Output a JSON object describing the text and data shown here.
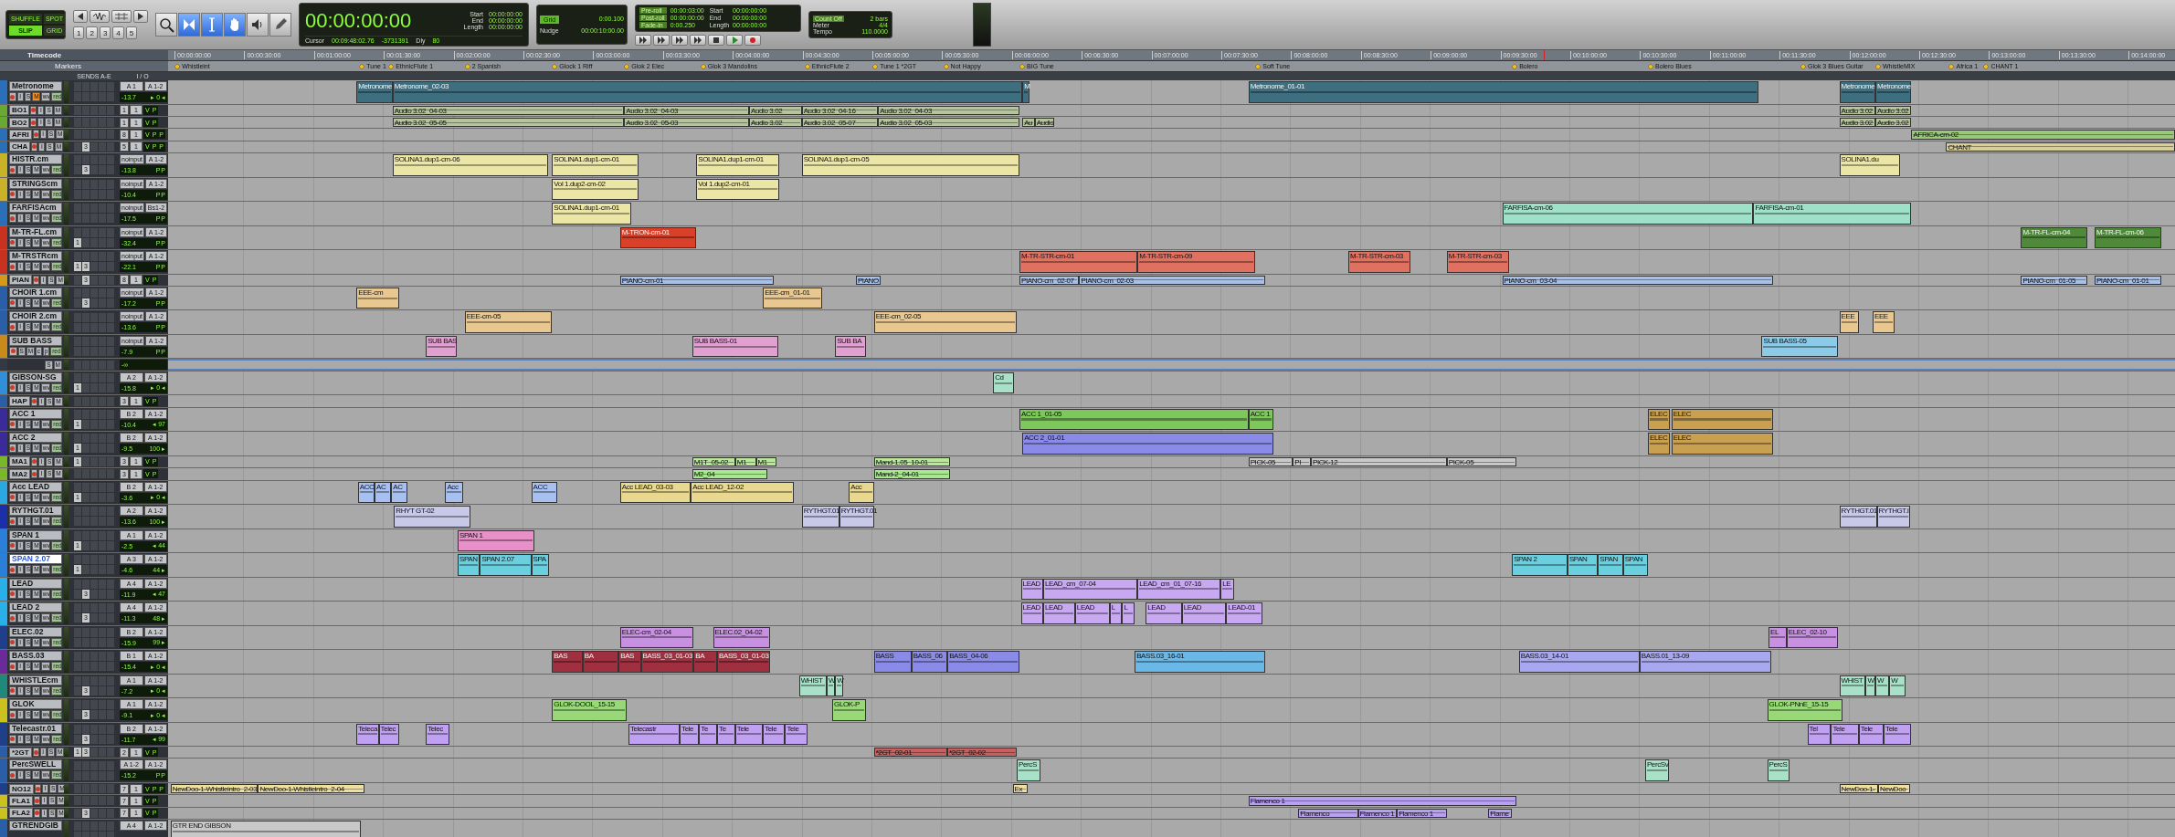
{
  "toolbar": {
    "edit_modes": [
      {
        "label": "SHUFFLE",
        "selected": false
      },
      {
        "label": "SPOT",
        "selected": false
      },
      {
        "label": "SLIP",
        "selected": true
      },
      {
        "label": "GRID",
        "selected": false
      }
    ],
    "zoom_presets": [
      "1",
      "2",
      "3",
      "4",
      "5"
    ],
    "tools": [
      {
        "kind": "zoomer",
        "selected": false
      },
      {
        "kind": "trimmer",
        "selected": true
      },
      {
        "kind": "selector",
        "selected": true
      },
      {
        "kind": "grabber",
        "selected": true
      },
      {
        "kind": "scrubber",
        "selected": false
      },
      {
        "kind": "pencil",
        "selected": false
      }
    ],
    "counter": {
      "main": "00:00:00:00",
      "selection": [
        {
          "label": "Start",
          "value": "00:00:00:00"
        },
        {
          "label": "End",
          "value": "00:00:00:00"
        },
        {
          "label": "Length",
          "value": "00:00:00:00"
        }
      ],
      "cursor_label": "Cursor",
      "cursor": "00:09:48:02.76",
      "sample": "-3731391",
      "delay_label": "Dly",
      "value": "80"
    },
    "grid": {
      "label": "Grid",
      "value": "0:00.100",
      "nudge_label": "Nudge",
      "nudge": "00:00:10:00.00"
    },
    "transport": {
      "rolls": [
        {
          "label": "Pre-roll",
          "value": "00:00:03:00"
        },
        {
          "label": "Post-roll",
          "value": "00:00:00:00"
        },
        {
          "label": "Fade-in",
          "value": "0:00.250"
        }
      ],
      "selection": [
        {
          "label": "Start",
          "value": "00:00:00:00"
        },
        {
          "label": "End",
          "value": "00:00:00:00"
        },
        {
          "label": "Length",
          "value": "00:00:00:00"
        }
      ]
    },
    "tempo": {
      "count_off": "Count Off",
      "bars": "2 bars",
      "meter_label": "Meter",
      "meter": "4/4",
      "tempo_label": "Tempo",
      "tempo": "110.0000"
    }
  },
  "ruler": {
    "label": "Timecode",
    "ticks": [
      "00:00:00:00",
      "00:00:30:00",
      "00:01:00:00",
      "00:01:30:00",
      "00:02:00:00",
      "00:02:30:00",
      "00:03:00:00",
      "00:03:30:00",
      "00:04:00:00",
      "00:04:30:00",
      "00:05:00:00",
      "00:05:30:00",
      "00:06:00:00",
      "00:06:30:00",
      "00:07:00:00",
      "00:07:30:00",
      "00:08:00:00",
      "00:08:30:00",
      "00:09:00:00",
      "00:09:30:00",
      "00:10:00:00",
      "00:10:30:00",
      "00:11:00:00",
      "00:11:30:00",
      "00:12:00:00",
      "00:12:30:00",
      "00:13:00:00",
      "00:13:30:00",
      "00:14:00:00"
    ]
  },
  "markers": {
    "label": "Markers",
    "items": [
      "Whistleint",
      "Tune 1",
      "EthnicFlute 1",
      "2 Spanish",
      "Glock 1 Riff",
      "Glok 2 Elec",
      "Glok 3 Mandolins",
      "EthnicFlute 2",
      "Tune 1 *2GT",
      "Not Happy",
      "BIG Tune",
      "Soft Tune",
      "Bolero",
      "Bolero Blues",
      "Glok 3 Blues Guitar",
      "WhistleMIX",
      "Africa 1",
      "CHANT 1"
    ]
  },
  "track_columns": {
    "sends": "SENDS A-E",
    "io": "I / O"
  },
  "tracks": [
    {
      "name": "Metronome",
      "kind": "double",
      "color": "#2a6fb8",
      "selected": false,
      "muted": true,
      "input_monitor": "I",
      "solo": "S",
      "mute": "M",
      "view": "wv",
      "automation": "red",
      "input": "A 1",
      "output": "A 1-2",
      "volume": "-13.7",
      "pan": "▸ 0 ◂",
      "clips": [
        {
          "name": "Metronome",
          "color": "#3d6f80"
        },
        {
          "name": "Metronome_02-03",
          "color": "#3d6f80"
        },
        {
          "name": "M",
          "color": "#3d6f80"
        },
        {
          "name": "Metronome_01-01",
          "color": "#3d6f80"
        },
        {
          "name": "Metronome",
          "color": "#3d6f80"
        },
        {
          "name": "Metronome",
          "color": "#3d6f80"
        }
      ]
    },
    {
      "name": "BO1",
      "kind": "single",
      "color": "#6aa834",
      "selected": false,
      "muted": false,
      "input_monitor": "I",
      "solo": "S",
      "mute": "M",
      "input": "1",
      "output": "1",
      "tags": [
        "V",
        "P"
      ],
      "clips": [
        {
          "name": "Audio 3.02_04-03",
          "color": "#b5c49a"
        },
        {
          "name": "Audio 3.02_04-03",
          "color": "#b5c49a"
        },
        {
          "name": "Audio 3.02",
          "color": "#b5c49a"
        },
        {
          "name": "Audio 3.02_04-16",
          "color": "#b5c49a"
        },
        {
          "name": "Audio 3.02_04-03",
          "color": "#b5c49a"
        },
        {
          "name": "Audio 3.02",
          "color": "#b5c49a"
        },
        {
          "name": "Audio 3.02",
          "color": "#b5c49a"
        }
      ]
    },
    {
      "name": "BO2",
      "kind": "single",
      "color": "#6aa834",
      "selected": false,
      "muted": false,
      "input_monitor": "I",
      "solo": "S",
      "mute": "M",
      "input": "1",
      "output": "1",
      "tags": [
        "V",
        "P"
      ],
      "clips": [
        {
          "name": "Audio 3.02_05-05",
          "color": "#b5c49a"
        },
        {
          "name": "Audio 3.02_05-03",
          "color": "#b5c49a"
        },
        {
          "name": "Audio 3.02",
          "color": "#b5c49a"
        },
        {
          "name": "Audio 3.02_05-07",
          "color": "#b5c49a"
        },
        {
          "name": "Audio 3.02_05-03",
          "color": "#b5c49a"
        },
        {
          "name": "Au",
          "color": "#b5c49a"
        },
        {
          "name": "Audio",
          "color": "#b5c49a"
        },
        {
          "name": "Audio 3.02",
          "color": "#b5c49a"
        },
        {
          "name": "Audio 3.02",
          "color": "#b5c49a"
        }
      ]
    },
    {
      "name": "AFRI",
      "kind": "single",
      "color": "#2a6fb8",
      "selected": false,
      "muted": false,
      "input_monitor": "I",
      "solo": "S",
      "mute": "M",
      "input": "8",
      "output": "1",
      "tags": [
        "V",
        "P",
        "P"
      ],
      "clips": [
        {
          "name": "AFRICA-cm-02",
          "color": "#9ac87a"
        }
      ]
    },
    {
      "name": "CHA",
      "kind": "single",
      "color": "#2a6fb8",
      "selected": false,
      "muted": false,
      "input_monitor": "I",
      "solo": "S",
      "mute": "M",
      "sends": {
        "B": "3"
      },
      "input": "5",
      "output": "1",
      "tags": [
        "V",
        "P",
        "P"
      ],
      "clips": [
        {
          "name": "CHANT",
          "color": "#d8cf98"
        }
      ]
    },
    {
      "name": "HISTR.cm",
      "kind": "double",
      "color": "#c9b227",
      "selected": false,
      "muted": false,
      "input_monitor": "I",
      "solo": "S",
      "mute": "M",
      "view": "wv",
      "automation": "red",
      "sends": {
        "B": "3"
      },
      "input": "noinput",
      "output": "A 1-2",
      "volume": "-13.8",
      "tags": [
        "P",
        "P"
      ],
      "clips": [
        {
          "name": "SOLINA1.dup1-cm-06",
          "color": "#ece6a6"
        },
        {
          "name": "SOLINA1.dup1-cm-01",
          "color": "#ece6a6"
        },
        {
          "name": "SOLINA1.dup1-cm-01",
          "color": "#ece6a6"
        },
        {
          "name": "SOLINA1.dup1-cm-05",
          "color": "#ece6a6"
        },
        {
          "name": "SOLINA1.du",
          "color": "#ece6a6"
        }
      ]
    },
    {
      "name": "STRINGScm",
      "kind": "double",
      "color": "#c9b227",
      "selected": false,
      "muted": false,
      "input_monitor": "I",
      "solo": "S",
      "mute": "M",
      "view": "wv",
      "automation": "red",
      "input": "noinput",
      "output": "A 1-2",
      "volume": "-10.4",
      "tags": [
        "P",
        "P"
      ],
      "clips": [
        {
          "name": "Vol 1.dup2-cm-02",
          "color": "#ece6a6"
        },
        {
          "name": "Vol 1.dup2-cm-01",
          "color": "#ece6a6"
        }
      ]
    },
    {
      "name": "FARFISAcm",
      "kind": "double",
      "color": "#2a6fb8",
      "selected": false,
      "muted": false,
      "input_monitor": "I",
      "solo": "S",
      "mute": "M",
      "view": "wv",
      "automation": "red",
      "input": "noinput",
      "output": "Bs1-2",
      "volume": "-17.5",
      "tags": [
        "P",
        "P"
      ],
      "clips": [
        {
          "name": "SOLINA1.dup1-cm-01",
          "color": "#ece6a6"
        },
        {
          "name": "FARFISA-cm-06",
          "color": "#9fe0c8"
        },
        {
          "name": "FARFISA-cm-01",
          "color": "#9fe0c8"
        }
      ]
    },
    {
      "name": "M-TR-FL.cm",
      "kind": "double",
      "color": "#c8321e",
      "selected": false,
      "muted": false,
      "input_monitor": "I",
      "solo": "S",
      "mute": "M",
      "view": "wv",
      "automation": "red",
      "sends": {
        "A": "1"
      },
      "input": "noinput",
      "output": "A 1-2",
      "volume": "-32.4",
      "tags": [
        "P",
        "P"
      ],
      "clips": [
        {
          "name": "M-TRON-cm-01",
          "color": "#d8402a"
        },
        {
          "name": "M-TR-FL-cm-04",
          "color": "#4f8a3a"
        },
        {
          "name": "M-TR-FL-cm-06",
          "color": "#4f8a3a"
        }
      ]
    },
    {
      "name": "M-TRSTRcm",
      "kind": "double",
      "color": "#c8321e",
      "selected": false,
      "muted": false,
      "input_monitor": "I",
      "solo": "S",
      "mute": "M",
      "view": "wv",
      "automation": "red",
      "sends": {
        "A": "1",
        "B": "3"
      },
      "input": "noinput",
      "output": "A 1-2",
      "volume": "-22.1",
      "tags": [
        "P",
        "P"
      ],
      "clips": [
        {
          "name": "M-TR-STR-cm-01",
          "color": "#e07060"
        },
        {
          "name": "M-TR-STR-cm-09",
          "color": "#e07060"
        },
        {
          "name": "M-TR-STR-cm-03",
          "color": "#e07060"
        },
        {
          "name": "M-TR-STR-cm-03",
          "color": "#e07060"
        }
      ]
    },
    {
      "name": "PIAN",
      "kind": "single",
      "color": "#d69a1a",
      "selected": false,
      "muted": false,
      "input_monitor": "I",
      "solo": "S",
      "mute": "M",
      "sends": {
        "B": "3"
      },
      "input": "8",
      "output": "1",
      "tags": [
        "V",
        "P"
      ],
      "clips": [
        {
          "name": "PIANO-cm-01",
          "color": "#a8c0e8"
        },
        {
          "name": "PIANO",
          "color": "#a8c0e8"
        },
        {
          "name": "PIANO-cm_02-07",
          "color": "#a8c0e8"
        },
        {
          "name": "PIANO-cm_02-03",
          "color": "#a8c0e8"
        },
        {
          "name": "PIANO-cm_03-04",
          "color": "#a8c0e8"
        },
        {
          "name": "PIANO-cm_01-05",
          "color": "#a8c0e8"
        },
        {
          "name": "PIANO-cm_01-01",
          "color": "#a8c0e8"
        }
      ]
    },
    {
      "name": "CHOIR 1.cm",
      "kind": "double",
      "color": "#2a5fa8",
      "selected": false,
      "muted": false,
      "input_monitor": "I",
      "solo": "S",
      "mute": "M",
      "view": "wv",
      "automation": "red",
      "sends": {
        "B": "3"
      },
      "input": "noinput",
      "output": "A 1-2",
      "volume": "-17.2",
      "tags": [
        "P",
        "P"
      ],
      "clips": [
        {
          "name": "EEE-cm",
          "color": "#e8c890"
        },
        {
          "name": "EEE-cm_01-01",
          "color": "#e8c890"
        }
      ]
    },
    {
      "name": "CHOIR 2.cm",
      "kind": "double",
      "color": "#2a5fa8",
      "selected": false,
      "muted": false,
      "input_monitor": "I",
      "solo": "S",
      "mute": "M",
      "view": "wv",
      "automation": "red",
      "input": "noinput",
      "output": "A 1-2",
      "volume": "-13.6",
      "tags": [
        "P",
        "P"
      ],
      "clips": [
        {
          "name": "EEE-cm-05",
          "color": "#e8c890"
        },
        {
          "name": "EEE-cm_02-05",
          "color": "#e8c890"
        },
        {
          "name": "EEE",
          "color": "#e8c890"
        },
        {
          "name": "EEE",
          "color": "#e8c890"
        }
      ]
    },
    {
      "name": "SUB BASS",
      "kind": "double",
      "color": "#c88a1a",
      "selected": false,
      "muted": false,
      "solo": "S",
      "mute": "M",
      "extras": [
        "c",
        "p"
      ],
      "automation": "red",
      "input": "noinput",
      "output": "A 1-2",
      "volume": "-7.9",
      "tags": [
        "P",
        "P"
      ],
      "clips": [
        {
          "name": "SUB BAS",
          "color": "#e0a0d0"
        },
        {
          "name": "SUB BASS-01",
          "color": "#e0a0d0"
        },
        {
          "name": "SUB BA",
          "color": "#e0a0d0"
        },
        {
          "name": "SUB BASS-05",
          "color": "#8ccbe8"
        }
      ]
    },
    {
      "kind": "blank",
      "color": "#333a44",
      "selected": false,
      "muted": false,
      "solo": "S",
      "mute": "M",
      "volume": "-∞"
    },
    {
      "name": "GIBSON-SG",
      "kind": "double",
      "color": "#2f8fd8",
      "selected": false,
      "muted": false,
      "input_monitor": "I",
      "solo": "S",
      "mute": "M",
      "view": "wv",
      "automation": "red",
      "sends": {
        "A": "1"
      },
      "input": "A 2",
      "output": "A 1-2",
      "volume": "-15.8",
      "pan": "▸ 0 ◂",
      "clips": [
        {
          "name": "Cd",
          "color": "#a8e0c8"
        }
      ]
    },
    {
      "name": "HAP",
      "kind": "single",
      "color": "#2a5fa8",
      "selected": false,
      "muted": false,
      "input_monitor": "I",
      "solo": "S",
      "mute": "M",
      "input": "3",
      "output": "1",
      "tags": [
        "V",
        "P"
      ]
    },
    {
      "name": "ACC 1",
      "kind": "double",
      "color": "#3b2a9a",
      "selected": false,
      "muted": false,
      "input_monitor": "I",
      "solo": "S",
      "mute": "M",
      "view": "wv",
      "automation": "red",
      "sends": {
        "A": "1"
      },
      "input": "B 2",
      "output": "A 1-2",
      "volume": "-10.4",
      "pan": "◂ 97",
      "clips": [
        {
          "name": "ACC 1_01-05",
          "color": "#7cc85a"
        },
        {
          "name": "ACC 1",
          "color": "#7cc85a"
        },
        {
          "name": "ELEC",
          "color": "#c8a050"
        },
        {
          "name": "ELEC",
          "color": "#c8a050"
        }
      ]
    },
    {
      "name": "ACC 2",
      "kind": "double",
      "color": "#3b2a9a",
      "selected": false,
      "muted": false,
      "input_monitor": "I",
      "solo": "S",
      "mute": "M",
      "view": "wv",
      "automation": "red",
      "sends": {
        "A": "1"
      },
      "input": "B 2",
      "output": "A 1-2",
      "volume": "-9.5",
      "pan": "100 ▸",
      "clips": [
        {
          "name": "ACC 2_01-01",
          "color": "#8a8ae8"
        },
        {
          "name": "ELEC",
          "color": "#c8a050"
        },
        {
          "name": "ELEC",
          "color": "#c8a050"
        }
      ]
    },
    {
      "name": "MA1",
      "kind": "single",
      "color": "#7ab82a",
      "selected": false,
      "muted": false,
      "input_monitor": "I",
      "solo": "S",
      "mute": "M",
      "sends": {
        "A": "1"
      },
      "input": "3",
      "output": "1",
      "tags": [
        "V",
        "P"
      ],
      "clips": [
        {
          "name": "M1T_05-02",
          "color": "#b8e898"
        },
        {
          "name": "M1",
          "color": "#b8e898"
        },
        {
          "name": "M1",
          "color": "#b8e898"
        },
        {
          "name": "Mand-1.05_10-01",
          "color": "#b8e898"
        },
        {
          "name": "PICK-05",
          "color": "#c8c8c8"
        },
        {
          "name": "PI",
          "color": "#c8c8c8"
        },
        {
          "name": "PICK-12",
          "color": "#c8c8c8"
        },
        {
          "name": "PICK-05",
          "color": "#c8c8c8"
        }
      ]
    },
    {
      "name": "MA2",
      "kind": "single",
      "color": "#7ab82a",
      "selected": false,
      "muted": false,
      "input_monitor": "I",
      "solo": "S",
      "mute": "M",
      "input": "3",
      "output": "1",
      "tags": [
        "V",
        "P"
      ],
      "clips": [
        {
          "name": "M2_04",
          "color": "#a8e890"
        },
        {
          "name": "Mand-2_04-01",
          "color": "#a8e890"
        }
      ]
    },
    {
      "name": "Acc LEAD",
      "kind": "double",
      "color": "#2aa8e0",
      "selected": false,
      "muted": false,
      "input_monitor": "I",
      "solo": "S",
      "mute": "M",
      "view": "wv",
      "automation": "red",
      "sends": {
        "A": "1"
      },
      "input": "B 2",
      "output": "A 1-2",
      "volume": "-3.6",
      "pan": "▸ 0 ◂",
      "clips": [
        {
          "name": "ACC",
          "color": "#a8c0f0"
        },
        {
          "name": "AC",
          "color": "#a8c0f0"
        },
        {
          "name": "AC",
          "color": "#a8c0f0"
        },
        {
          "name": "Acc",
          "color": "#a8c0f0"
        },
        {
          "name": "ACC",
          "color": "#a8c0f0"
        },
        {
          "name": "Acc LEAD_03-03",
          "color": "#e8d890"
        },
        {
          "name": "Acc LEAD_12-02",
          "color": "#e8d890"
        },
        {
          "name": "Acc",
          "color": "#e8d890"
        }
      ]
    },
    {
      "name": "RYTHGT.01",
      "kind": "double",
      "color": "#1a2fa8",
      "selected": false,
      "muted": false,
      "input_monitor": "I",
      "solo": "S",
      "mute": "M",
      "view": "wv",
      "automation": "red",
      "input": "A 2",
      "output": "A 1-2",
      "volume": "-13.6",
      "pan": "100 ▸",
      "clips": [
        {
          "name": "RHYT GT-02",
          "color": "#c8c8e8"
        },
        {
          "name": "RYTHGT.01",
          "color": "#c8c8e8"
        },
        {
          "name": "RYTHGT.01",
          "color": "#c8c8e8"
        },
        {
          "name": "RYTHGT.01",
          "color": "#c8c8e8"
        },
        {
          "name": "RYTHGT.I",
          "color": "#c8c8e8"
        }
      ]
    },
    {
      "name": "SPAN 1",
      "kind": "double",
      "color": "#2a7fd8",
      "selected": false,
      "muted": false,
      "input_monitor": "I",
      "solo": "S",
      "mute": "M",
      "view": "wv",
      "automation": "red",
      "sends": {
        "A": "1"
      },
      "input": "A 1",
      "output": "A 1-2",
      "volume": "-2.5",
      "pan": "◂ 44",
      "clips": [
        {
          "name": "SPAN 1",
          "color": "#e890c8"
        }
      ]
    },
    {
      "name": "SPAN 2.07",
      "kind": "double",
      "color": "#2a7fd8",
      "selected": true,
      "muted": false,
      "input_monitor": "I",
      "solo": "S",
      "mute": "M",
      "view": "wv",
      "automation": "red",
      "sends": {
        "A": "1"
      },
      "input": "A 3",
      "output": "A 1-2",
      "volume": "-4.6",
      "pan": "44 ▸",
      "clips": [
        {
          "name": "SPAN",
          "color": "#6ad0e0"
        },
        {
          "name": "SPAN 2.07",
          "color": "#6ad0e0"
        },
        {
          "name": "SPA",
          "color": "#6ad0e0"
        },
        {
          "name": "SPAN 2",
          "color": "#6ad0e0"
        },
        {
          "name": "SPAN",
          "color": "#6ad0e0"
        },
        {
          "name": "SPAN",
          "color": "#6ad0e0"
        },
        {
          "name": "SPAN",
          "color": "#6ad0e0"
        }
      ]
    },
    {
      "name": "LEAD",
      "kind": "double",
      "color": "#2ab0e8",
      "selected": false,
      "muted": false,
      "input_monitor": "I",
      "solo": "S",
      "mute": "M",
      "view": "wv",
      "automation": "red",
      "sends": {
        "B": "3"
      },
      "input": "A 4",
      "output": "A 1-2",
      "volume": "-11.9",
      "pan": "◂ 47",
      "clips": [
        {
          "name": "LEAD",
          "color": "#c8a8f0"
        },
        {
          "name": "LEAD_cm_07-04",
          "color": "#c8a8f0"
        },
        {
          "name": "LEAD_cm_01_07-16",
          "color": "#c8a8f0"
        },
        {
          "name": "LE",
          "color": "#c8a8f0"
        }
      ]
    },
    {
      "name": "LEAD 2",
      "kind": "double",
      "color": "#2ab0e8",
      "selected": false,
      "muted": false,
      "input_monitor": "I",
      "solo": "S",
      "mute": "M",
      "view": "wv",
      "automation": "red",
      "sends": {
        "B": "3"
      },
      "input": "A 4",
      "output": "A 1-2",
      "volume": "-11.3",
      "pan": "48 ▸",
      "clips": [
        {
          "name": "LEAD",
          "color": "#c8a8f0"
        },
        {
          "name": "LEAD",
          "color": "#c8a8f0"
        },
        {
          "name": "LEAD",
          "color": "#c8a8f0"
        },
        {
          "name": "L",
          "color": "#c8a8f0"
        },
        {
          "name": "L",
          "color": "#c8a8f0"
        },
        {
          "name": "LEAD",
          "color": "#c8a8f0"
        },
        {
          "name": "LEAD",
          "color": "#c8a8f0"
        },
        {
          "name": "LEAD-01",
          "color": "#c8a8f0"
        }
      ]
    },
    {
      "name": "ELEC.02",
      "kind": "double",
      "color": "#1f3f8a",
      "selected": false,
      "muted": false,
      "input_monitor": "I",
      "solo": "S",
      "mute": "M",
      "view": "wv",
      "automation": "red",
      "input": "B 2",
      "output": "A 1-2",
      "volume": "-15.9",
      "pan": "99 ▸",
      "clips": [
        {
          "name": "ELEC-cm_02-04",
          "color": "#c890e0"
        },
        {
          "name": "ELEC.02_04-02",
          "color": "#c890e0"
        },
        {
          "name": "EL",
          "color": "#c890e0"
        },
        {
          "name": "ELEC_02-10",
          "color": "#c890e0"
        }
      ]
    },
    {
      "name": "BASS.03",
      "kind": "double",
      "color": "#6a2a9a",
      "selected": false,
      "muted": false,
      "input_monitor": "I",
      "solo": "S",
      "mute": "M",
      "view": "wv",
      "automation": "red",
      "input": "B 1",
      "output": "A 1-2",
      "volume": "-15.4",
      "pan": "▸ 0 ◂",
      "clips": [
        {
          "name": "BAS",
          "color": "#a03040"
        },
        {
          "name": "BA",
          "color": "#a03040"
        },
        {
          "name": "BAS",
          "color": "#a03040"
        },
        {
          "name": "BASS_03_01-03",
          "color": "#a03040"
        },
        {
          "name": "BA",
          "color": "#a03040"
        },
        {
          "name": "BASS_03_01-03",
          "color": "#a03040"
        },
        {
          "name": "BASS",
          "color": "#8a8ae8"
        },
        {
          "name": "BASS_06",
          "color": "#8a8ae8"
        },
        {
          "name": "BASS_04-06",
          "color": "#8a8ae8"
        },
        {
          "name": "BASS.03_16-01",
          "color": "#6ab8e8"
        },
        {
          "name": "BASS.03_14-01",
          "color": "#a8a8f0"
        },
        {
          "name": "BASS.01_13-09",
          "color": "#a8a8f0"
        }
      ]
    },
    {
      "name": "WHISTLEcm",
      "kind": "double",
      "color": "#1f8a7a",
      "selected": false,
      "muted": false,
      "input_monitor": "I",
      "solo": "S",
      "mute": "M",
      "view": "wv",
      "automation": "red",
      "sends": {
        "B": "3"
      },
      "input": "A 1",
      "output": "A 1-2",
      "volume": "-7.2",
      "pan": "▸ 0 ◂",
      "clips": [
        {
          "name": "WHIST",
          "color": "#a8e0c8"
        },
        {
          "name": "W",
          "color": "#a8e0c8"
        },
        {
          "name": "W",
          "color": "#a8e0c8"
        },
        {
          "name": "WHIST",
          "color": "#a8e0c8"
        },
        {
          "name": "W",
          "color": "#a8e0c8"
        },
        {
          "name": "W",
          "color": "#a8e0c8"
        },
        {
          "name": "W",
          "color": "#a8e0c8"
        }
      ]
    },
    {
      "name": "GLOK",
      "kind": "double",
      "color": "#c9c21f",
      "selected": false,
      "muted": false,
      "input_monitor": "I",
      "solo": "S",
      "mute": "M",
      "view": "wv",
      "automation": "red",
      "sends": {
        "B": "3"
      },
      "input": "A 1",
      "output": "A 1-2",
      "volume": "-9.1",
      "pan": "▸ 0 ◂",
      "clips": [
        {
          "name": "GLOK-DOOL_15-15",
          "color": "#98d878"
        },
        {
          "name": "GLOK-P",
          "color": "#98d878"
        },
        {
          "name": "GLOK-PNnE_15-15",
          "color": "#98d878"
        }
      ]
    },
    {
      "name": "Telecastr.01",
      "kind": "double",
      "color": "#1f3f8a",
      "selected": false,
      "muted": false,
      "input_monitor": "I",
      "solo": "S",
      "mute": "M",
      "view": "wv",
      "automation": "red",
      "sends": {
        "B": "3"
      },
      "input": "B 2",
      "output": "A 1-2",
      "volume": "-11.7",
      "pan": "◂ 99",
      "clips": [
        {
          "name": "Teleca",
          "color": "#c0a0f0"
        },
        {
          "name": "Telec",
          "color": "#c0a0f0"
        },
        {
          "name": "Telec",
          "color": "#c0a0f0"
        },
        {
          "name": "Telecastr",
          "color": "#c0a0f0"
        },
        {
          "name": "Tele",
          "color": "#c0a0f0"
        },
        {
          "name": "Te",
          "color": "#c0a0f0"
        },
        {
          "name": "Te",
          "color": "#c0a0f0"
        },
        {
          "name": "Tele",
          "color": "#c0a0f0"
        },
        {
          "name": "Tele",
          "color": "#c0a0f0"
        },
        {
          "name": "Tele",
          "color": "#c0a0f0"
        },
        {
          "name": "Tel",
          "color": "#c0a0f0"
        },
        {
          "name": "Tele",
          "color": "#c0a0f0"
        },
        {
          "name": "Tele",
          "color": "#c0a0f0"
        },
        {
          "name": "Tele",
          "color": "#c0a0f0"
        }
      ]
    },
    {
      "name": "*2GT",
      "kind": "single",
      "color": "#2a5fa8",
      "selected": false,
      "muted": false,
      "input_monitor": "I",
      "solo": "S",
      "mute": "M",
      "sends": {
        "A": "1",
        "B": "3"
      },
      "input": "2",
      "output": "1",
      "tags": [
        "V",
        "P"
      ],
      "clips": [
        {
          "name": "*2GT_02-01",
          "color": "#c86060"
        },
        {
          "name": "*2GT_02-02",
          "color": "#c86060"
        }
      ]
    },
    {
      "name": "PercSWELL",
      "kind": "double",
      "color": "#2a5fa8",
      "selected": false,
      "muted": false,
      "input_monitor": "I",
      "solo": "S",
      "mute": "M",
      "view": "wv",
      "automation": "red",
      "input": "A 1-2",
      "output": "A 1-2",
      "volume": "-15.2",
      "tags": [
        "P",
        "P"
      ],
      "clips": [
        {
          "name": "PercS",
          "color": "#a8e0c8"
        },
        {
          "name": "PercSv",
          "color": "#a8e0c8"
        },
        {
          "name": "PercS",
          "color": "#a8e0c8"
        }
      ]
    },
    {
      "name": "NO12",
      "kind": "single",
      "color": "#1f3f8a",
      "selected": false,
      "muted": false,
      "input_monitor": "I",
      "solo": "S",
      "mute": "M",
      "input": "7",
      "output": "1",
      "tags": [
        "V",
        "P",
        "P"
      ],
      "clips": [
        {
          "name": "NewDoo-1-Whistleintro_2-03",
          "color": "#f0e0a0"
        },
        {
          "name": "NewDoo-1-Whistleintro_2-04",
          "color": "#f0e0a0"
        },
        {
          "name": "Ex",
          "color": "#f0e0a0"
        },
        {
          "name": "NewDoo-1-",
          "color": "#f0e0a0"
        },
        {
          "name": "NewDoo",
          "color": "#f0e0a0"
        }
      ]
    },
    {
      "name": "FLA1",
      "kind": "single",
      "color": "#c9c21f",
      "selected": false,
      "muted": false,
      "input_monitor": "I",
      "solo": "S",
      "mute": "M",
      "input": "7",
      "output": "1",
      "tags": [
        "V",
        "P"
      ],
      "clips": [
        {
          "name": "Flamenco 1",
          "color": "#b8a0f0"
        }
      ]
    },
    {
      "name": "FLA2",
      "kind": "single",
      "color": "#c9c21f",
      "selected": false,
      "muted": false,
      "input_monitor": "I",
      "solo": "S",
      "mute": "M",
      "sends": {
        "B": "3"
      },
      "input": "7",
      "output": "1",
      "tags": [
        "V",
        "P"
      ],
      "clips": [
        {
          "name": "Flamenco",
          "color": "#b8a0f0"
        },
        {
          "name": "Flamenco 1",
          "color": "#b8a0f0"
        },
        {
          "name": "Flamenco 1",
          "color": "#b8a0f0"
        },
        {
          "name": "Flame",
          "color": "#b8a0f0"
        }
      ]
    },
    {
      "name": "GTRENDGIB",
      "kind": "double",
      "color": "#2a5fa8",
      "selected": false,
      "input": "A 4",
      "output": "A 1-2",
      "clips": [
        {
          "name": "GTR END GIBSON",
          "color": "#c8c8c8"
        }
      ]
    }
  ]
}
